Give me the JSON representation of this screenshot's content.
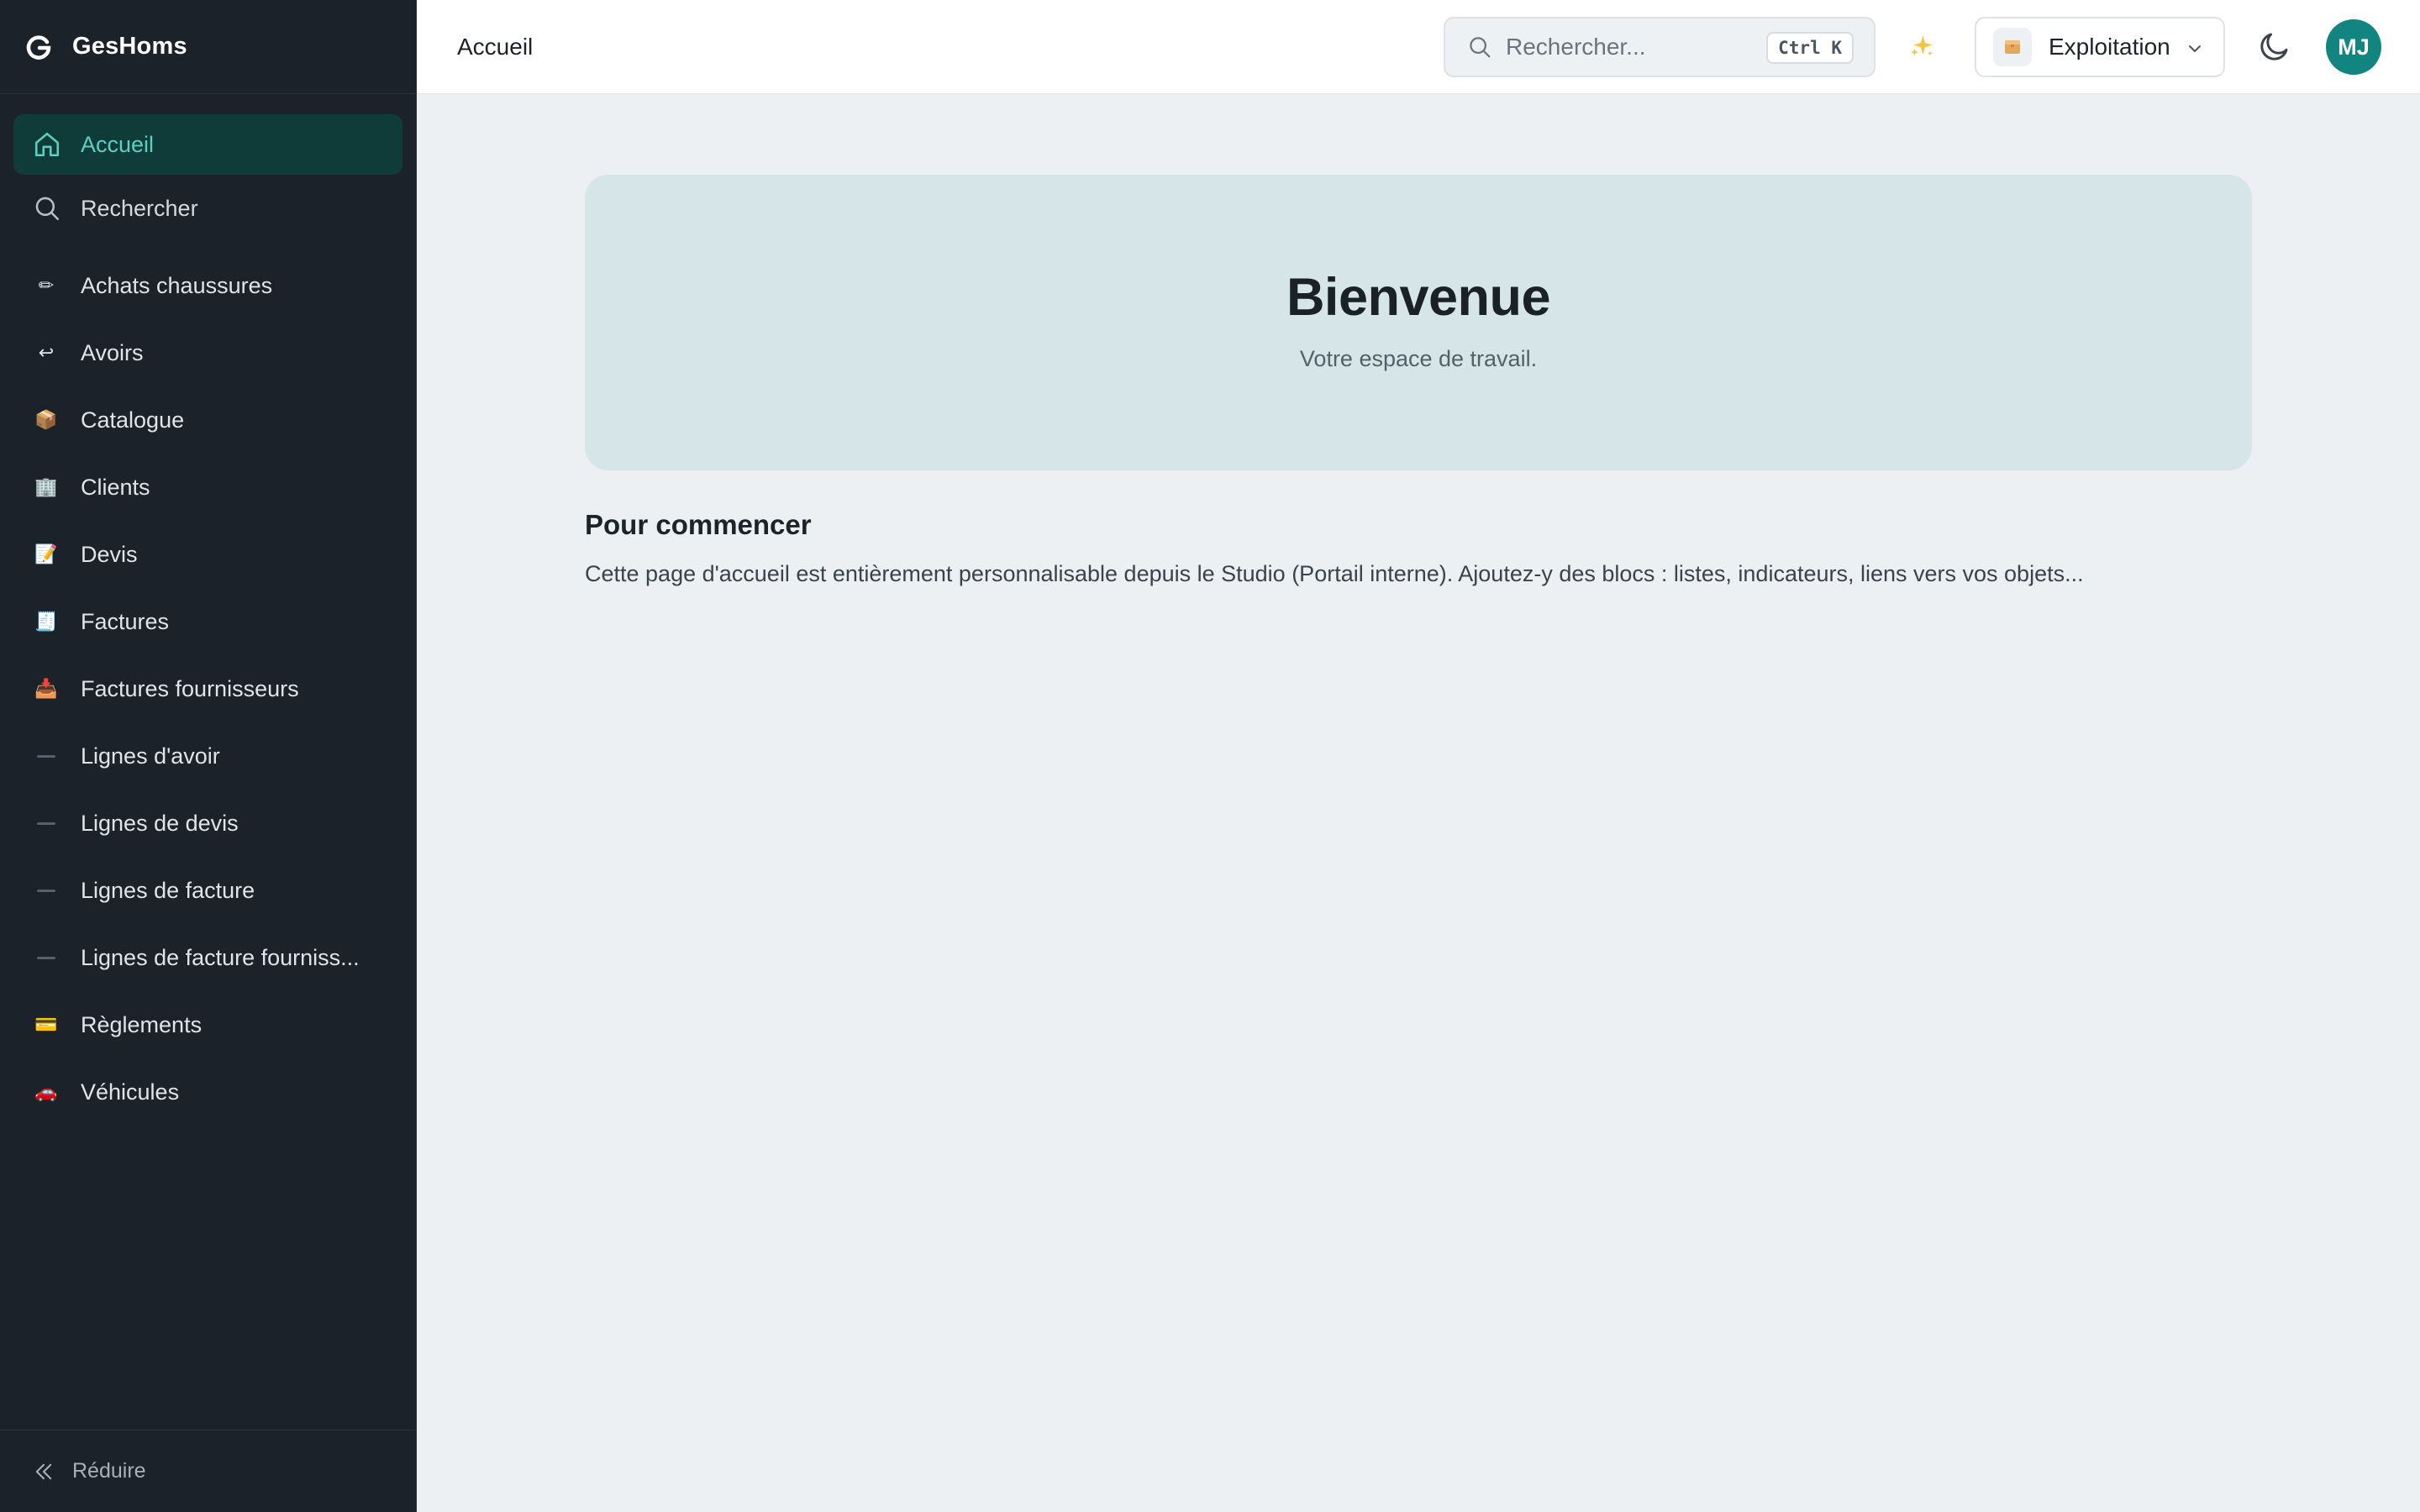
{
  "app": {
    "name": "GesHoms"
  },
  "header": {
    "title": "Accueil",
    "search_placeholder": "Rechercher...",
    "search_shortcut": "Ctrl K",
    "workspace": "Exploitation",
    "user_initials": "MJ"
  },
  "sidebar": {
    "top": [
      {
        "label": "Accueil",
        "icon": "home-icon",
        "active": true
      },
      {
        "label": "Rechercher",
        "icon": "search-icon",
        "active": false
      }
    ],
    "items": [
      {
        "label": "Achats chaussures",
        "icon": "✏"
      },
      {
        "label": "Avoirs",
        "icon": "↩"
      },
      {
        "label": "Catalogue",
        "icon": "📦"
      },
      {
        "label": "Clients",
        "icon": "🏢"
      },
      {
        "label": "Devis",
        "icon": "📝"
      },
      {
        "label": "Factures",
        "icon": "🧾"
      },
      {
        "label": "Factures fournisseurs",
        "icon": "📥"
      },
      {
        "label": "Lignes d'avoir",
        "icon": "dash"
      },
      {
        "label": "Lignes de devis",
        "icon": "dash"
      },
      {
        "label": "Lignes de facture",
        "icon": "dash"
      },
      {
        "label": "Lignes de facture fourniss...",
        "icon": "dash"
      },
      {
        "label": "Règlements",
        "icon": "💳"
      },
      {
        "label": "Véhicules",
        "icon": "🚗"
      }
    ],
    "collapse_label": "Réduire"
  },
  "main": {
    "hero_title": "Bienvenue",
    "hero_subtitle": "Votre espace de travail.",
    "section_title": "Pour commencer",
    "section_text": "Cette page d'accueil est entièrement personnalisable depuis le Studio (Portail interne). Ajoutez-y des blocs : listes, indicateurs, liens vers vos objets..."
  },
  "colors": {
    "sidebar_bg": "#1b222a",
    "active_bg": "#0f3b39",
    "active_text": "#5bd0c2",
    "hero_bg": "#d6e5e8",
    "avatar_bg": "#138580",
    "page_bg": "#ecf0f2"
  }
}
